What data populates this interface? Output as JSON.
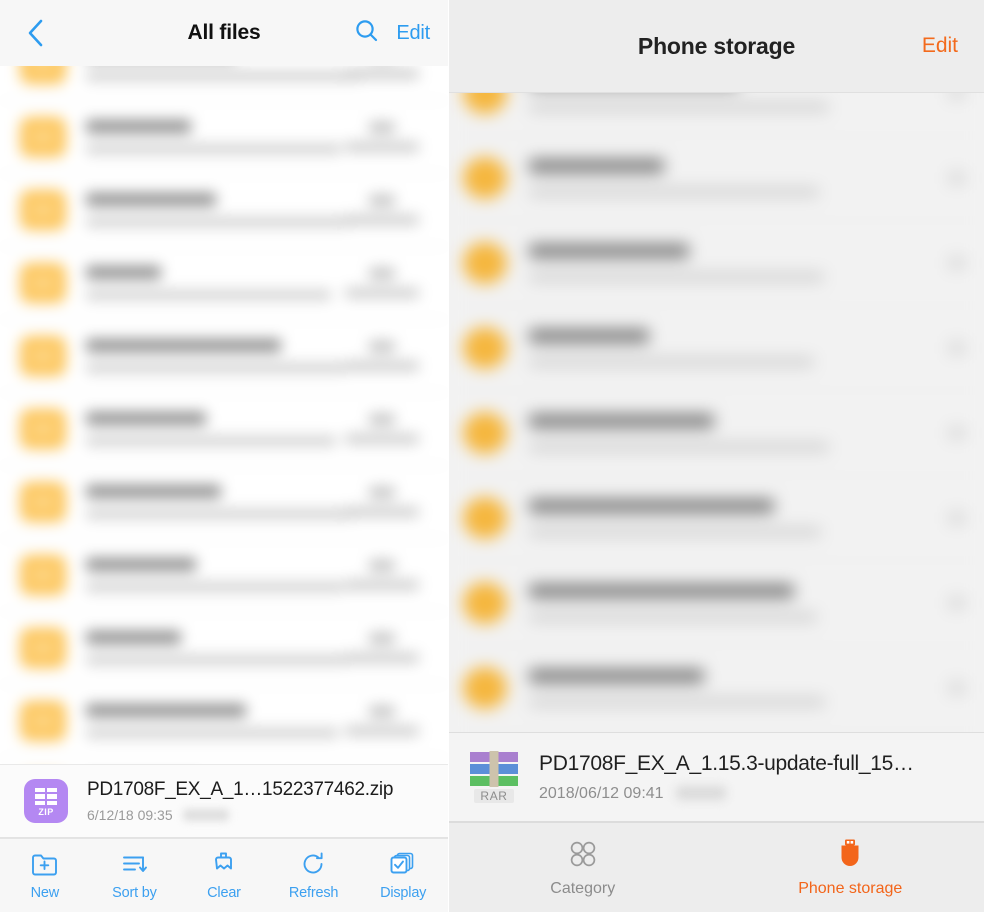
{
  "colors": {
    "ios_accent": "#2d9cf0",
    "android_accent": "#f3651a",
    "folder_orange": "#f5b73f",
    "zip_purple": "#b488f2",
    "title_dark": "#111111"
  },
  "left_panel": {
    "header": {
      "back_icon": "chevron-left-icon",
      "title": "All files",
      "search_icon": "search-icon",
      "edit_label": "Edit"
    },
    "list": {
      "blurred": true,
      "row_count": 11,
      "row_icon": "folder-icon",
      "note": "file list rows are motion-blurred and unreadable"
    },
    "selected_file": {
      "icon": "zip-archive-icon",
      "icon_label": "ZIP",
      "name": "PD1708F_EX_A_1…1522377462.zip",
      "date": "6/12/18 09:35"
    },
    "toolbar": [
      {
        "icon": "new-folder-icon",
        "label": "New"
      },
      {
        "icon": "sort-icon",
        "label": "Sort by"
      },
      {
        "icon": "brush-clear-icon",
        "label": "Clear"
      },
      {
        "icon": "refresh-icon",
        "label": "Refresh"
      },
      {
        "icon": "display-icon",
        "label": "Display"
      }
    ]
  },
  "right_panel": {
    "header": {
      "title": "Phone storage",
      "edit_label": "Edit"
    },
    "list": {
      "blurred": true,
      "row_count": 9,
      "row_icon": "folder-circle-icon",
      "note": "file list rows are motion-blurred and unreadable"
    },
    "selected_file": {
      "icon": "rar-archive-icon",
      "icon_label": "RAR",
      "name": "PD1708F_EX_A_1.15.3-update-full_15…",
      "date": "2018/06/12 09:41"
    },
    "tabs": [
      {
        "icon": "category-grid-icon",
        "label": "Category",
        "active": false
      },
      {
        "icon": "usb-drive-icon",
        "label": "Phone storage",
        "active": true
      }
    ]
  }
}
